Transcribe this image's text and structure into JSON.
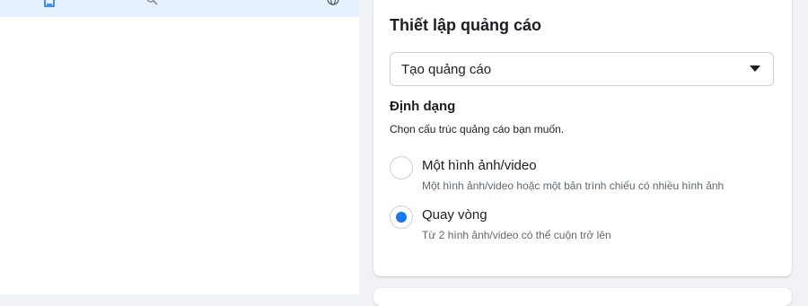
{
  "left_toolbar": {
    "icons": [
      "document-icon",
      "search-icon",
      "globe-icon"
    ]
  },
  "ad_setup": {
    "title": "Thiết lập quảng cáo",
    "select": {
      "value": "Tạo quảng cáo"
    },
    "format": {
      "title": "Định dạng",
      "description": "Chọn cấu trúc quảng cáo bạn muốn.",
      "options": [
        {
          "label": "Một hình ảnh/video",
          "description": "Một hình ảnh/video hoặc một bản trình chiếu có nhiều hình ảnh",
          "selected": false
        },
        {
          "label": "Quay vòng",
          "description": "Từ 2 hình ảnh/video có thể cuộn trở lên",
          "selected": true
        }
      ]
    }
  },
  "colors": {
    "accent": "#1877f2",
    "background": "#f0f2f5",
    "left_bar_highlight": "#e7f0fd"
  }
}
